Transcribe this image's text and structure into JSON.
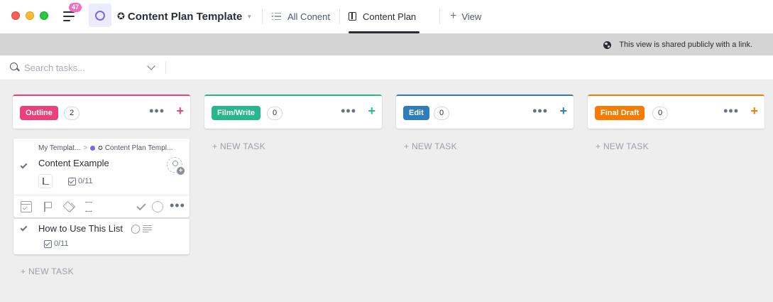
{
  "topbar": {
    "notification_count": "47",
    "title_star": "✪",
    "page_title": "Content Plan Template",
    "title_caret": "▼",
    "views": [
      {
        "label": "All Conent"
      },
      {
        "label": "Content Plan",
        "active": true
      },
      {
        "label": "View",
        "prefix": "+"
      }
    ],
    "accent_color": "#7b68ee"
  },
  "banner": {
    "text": "This view is shared publicly with a link."
  },
  "search": {
    "placeholder": "Search tasks...",
    "value": ""
  },
  "columns": [
    {
      "name": "Outline",
      "count": "2",
      "color": "#ec407a",
      "new_task_label": "+ NEW TASK",
      "tasks": [
        {
          "breadcrumb_list": "My Templat...",
          "breadcrumb_sep": ">",
          "breadcrumb_folder": "Content Plan Templ...",
          "breadcrumb_star": "✪",
          "name": "Content Example",
          "checklist": "0/11",
          "expanded": true
        },
        {
          "name": "How to Use This List",
          "checklist": "0/11",
          "has_attachment": true,
          "has_description": true
        }
      ]
    },
    {
      "name": "Film/Write",
      "count": "0",
      "color": "#26b88c",
      "new_task_label": "+ NEW TASK",
      "tasks": []
    },
    {
      "name": "Edit",
      "count": "0",
      "color": "#2e7db8",
      "new_task_label": "+ NEW TASK",
      "tasks": []
    },
    {
      "name": "Final Draft",
      "count": "0",
      "color": "#f57c00",
      "new_task_label": "+ NEW TASK",
      "tasks": []
    }
  ],
  "icons": {
    "more": "•••",
    "add": "+"
  }
}
